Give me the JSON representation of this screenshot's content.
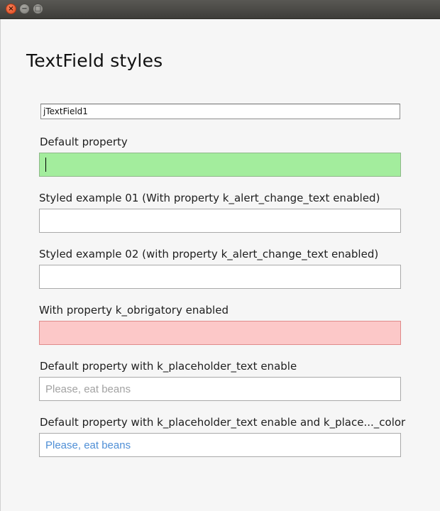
{
  "window": {
    "close_glyph": "×",
    "min_glyph": "−",
    "max_glyph": "□"
  },
  "title": "TextField styles",
  "jtextfield": {
    "value": "jTextField1"
  },
  "fields": [
    {
      "label": "Default property",
      "value": "",
      "placeholder": ""
    },
    {
      "label": "Styled example 01 (With property k_alert_change_text enabled)",
      "value": "",
      "placeholder": ""
    },
    {
      "label": "Styled example 02 (with property k_alert_change_text enabled)",
      "value": "",
      "placeholder": ""
    },
    {
      "label": "With property k_obrigatory enabled",
      "value": "",
      "placeholder": ""
    },
    {
      "label": "Default property with k_placeholder_text enable",
      "value": "",
      "placeholder": "Please, eat beans"
    },
    {
      "label": "Default property with k_placeholder_text enable and k_place..._color",
      "value": "",
      "placeholder": "Please, eat beans"
    }
  ],
  "colors": {
    "focused_bg": "#a3ed9d",
    "obrigatory_bg": "#fcc8c8",
    "placeholder_color_blue": "#4f8fd6"
  }
}
